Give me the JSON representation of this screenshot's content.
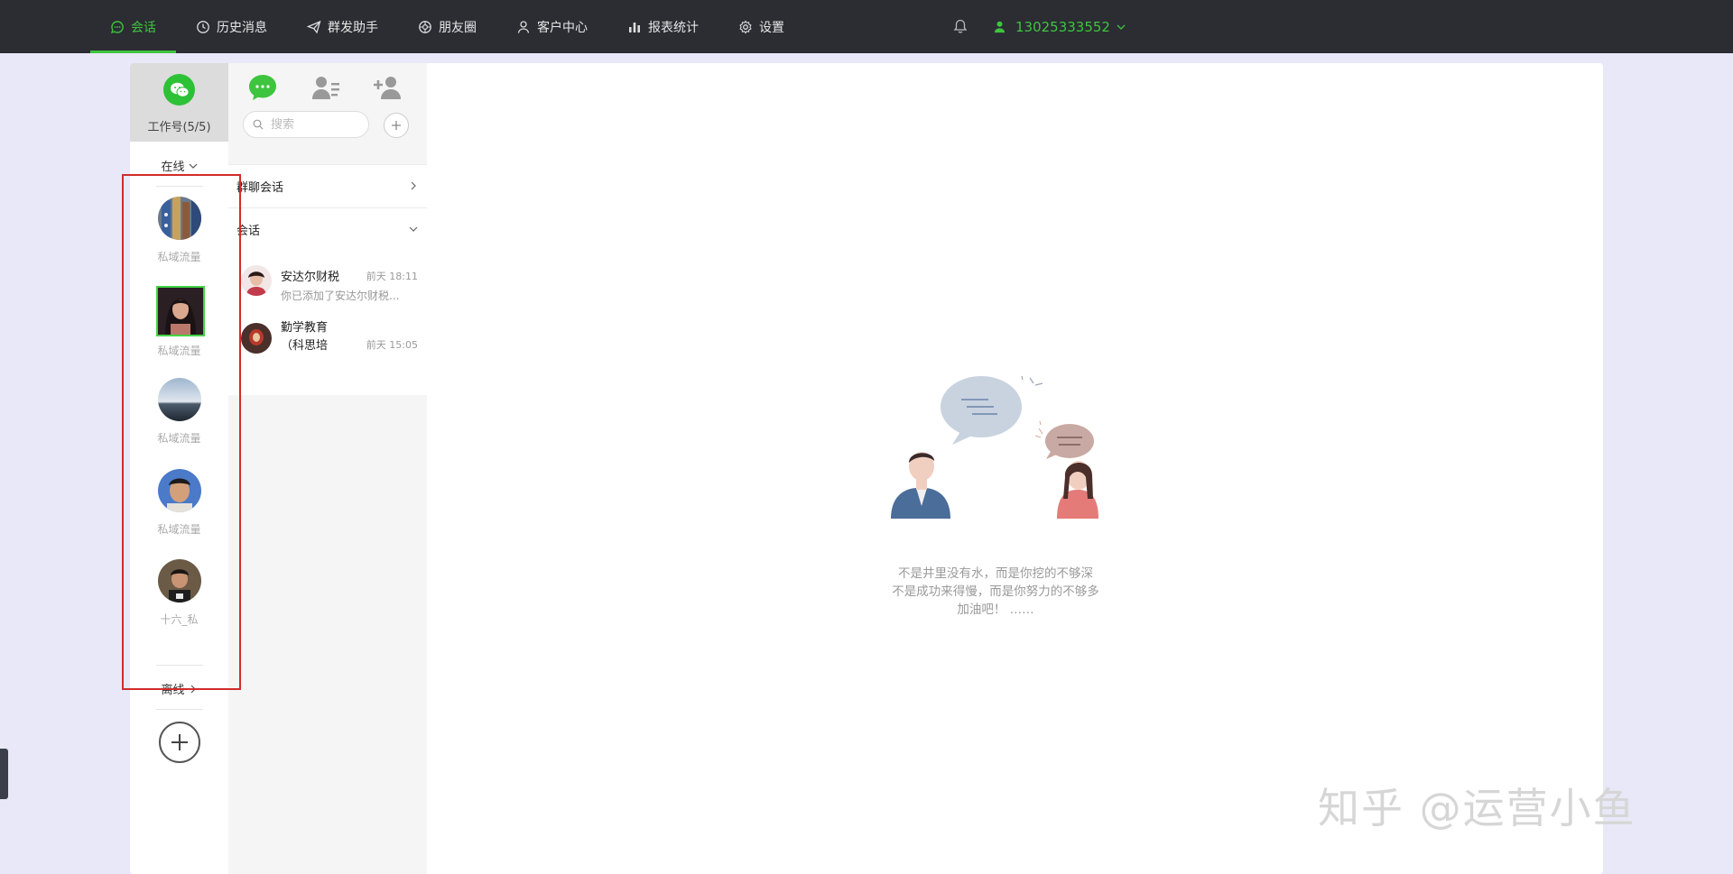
{
  "nav": {
    "items": [
      {
        "label": "会话",
        "icon": "chat-icon",
        "active": true
      },
      {
        "label": "历史消息",
        "icon": "clock-icon",
        "active": false
      },
      {
        "label": "群发助手",
        "icon": "send-icon",
        "active": false
      },
      {
        "label": "朋友圈",
        "icon": "aperture-icon",
        "active": false
      },
      {
        "label": "客户中心",
        "icon": "person-icon",
        "active": false
      },
      {
        "label": "报表统计",
        "icon": "bar-chart-icon",
        "active": false
      },
      {
        "label": "设置",
        "icon": "gear-icon",
        "active": false
      }
    ],
    "user_phone": "13025333552"
  },
  "accounts": {
    "header_label": "工作号(5/5)",
    "online_label": "在线",
    "offline_label": "离线",
    "items": [
      {
        "label": "私域流量",
        "selected": false
      },
      {
        "label": "私域流量",
        "selected": true
      },
      {
        "label": "私域流量",
        "selected": false
      },
      {
        "label": "私域流量",
        "selected": false
      },
      {
        "label": "十六_私",
        "selected": false
      }
    ]
  },
  "conversations": {
    "search_placeholder": "搜索",
    "group_section": "群聊会话",
    "chat_section": "会话",
    "items": [
      {
        "name": "安达尔财税",
        "time": "前天 18:11",
        "preview": "你已添加了安达尔财税..."
      },
      {
        "name": "勤学教育",
        "name2": "（科思培",
        "time": "前天 15:05",
        "preview": ""
      }
    ]
  },
  "empty_state": {
    "line1": "不是井里没有水，而是你挖的不够深",
    "line2": "不是成功来得慢，而是你努力的不够多",
    "line3": "加油吧！ ……"
  },
  "watermark": "知乎 @运营小鱼",
  "colors": {
    "accent": "#3fc43f",
    "topbar": "#2b2d33",
    "highlight_box": "#d22b2b"
  }
}
